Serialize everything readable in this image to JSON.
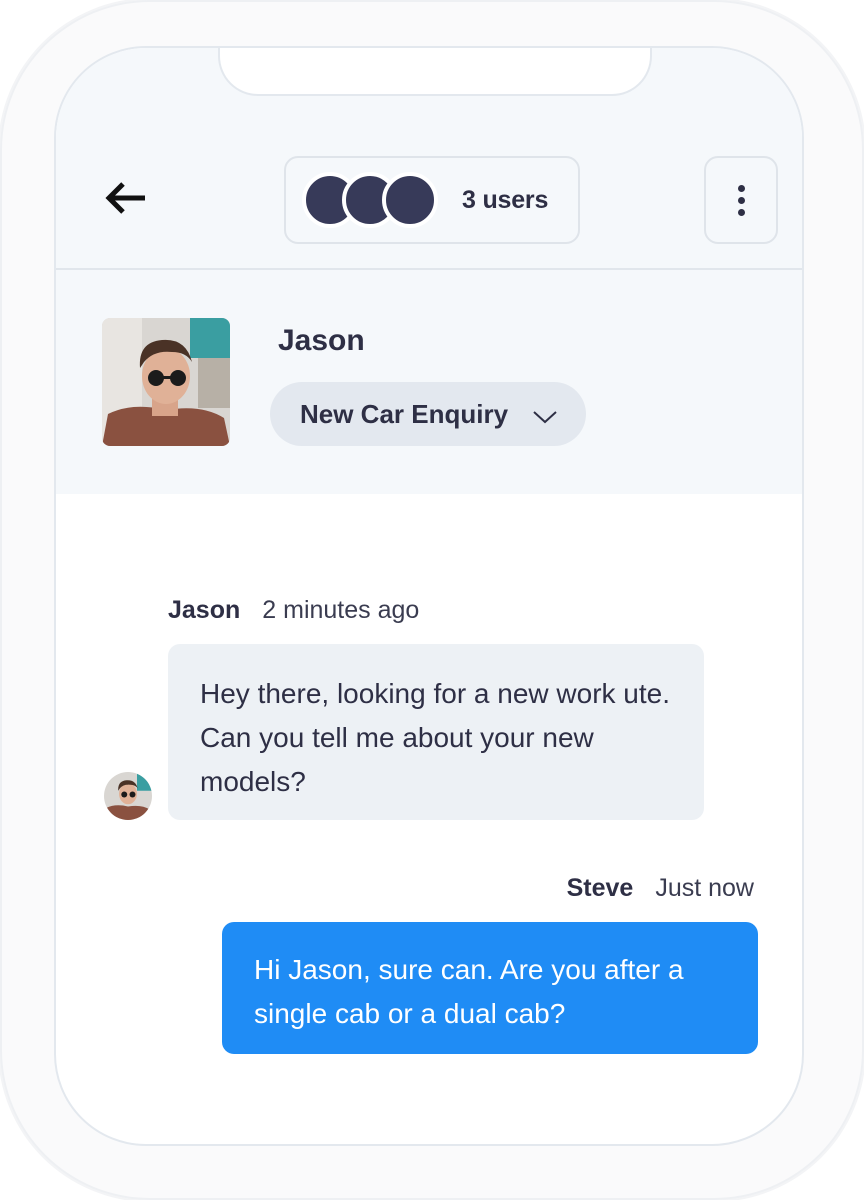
{
  "header": {
    "back_icon": "arrow-left-icon",
    "users_label": "3 users",
    "menu_icon": "vertical-dots-icon",
    "avatar_dot_color": "#373a59"
  },
  "contact": {
    "name": "Jason",
    "topic": "New Car Enquiry",
    "topic_icon": "chevron-down-icon"
  },
  "messages": [
    {
      "sender": "Jason",
      "time": "2 minutes ago",
      "text": "Hey there, looking for a new work ute. Can you tell me about your new models?",
      "direction": "incoming"
    },
    {
      "sender": "Steve",
      "time": "Just now",
      "text": "Hi Jason, sure can. Are you after a single cab or a dual cab?",
      "direction": "outgoing"
    }
  ],
  "colors": {
    "accent": "#1f8cf5",
    "incoming_bubble": "#edf1f5",
    "text": "#2e2f45",
    "header_bg": "#f5f8fb"
  }
}
